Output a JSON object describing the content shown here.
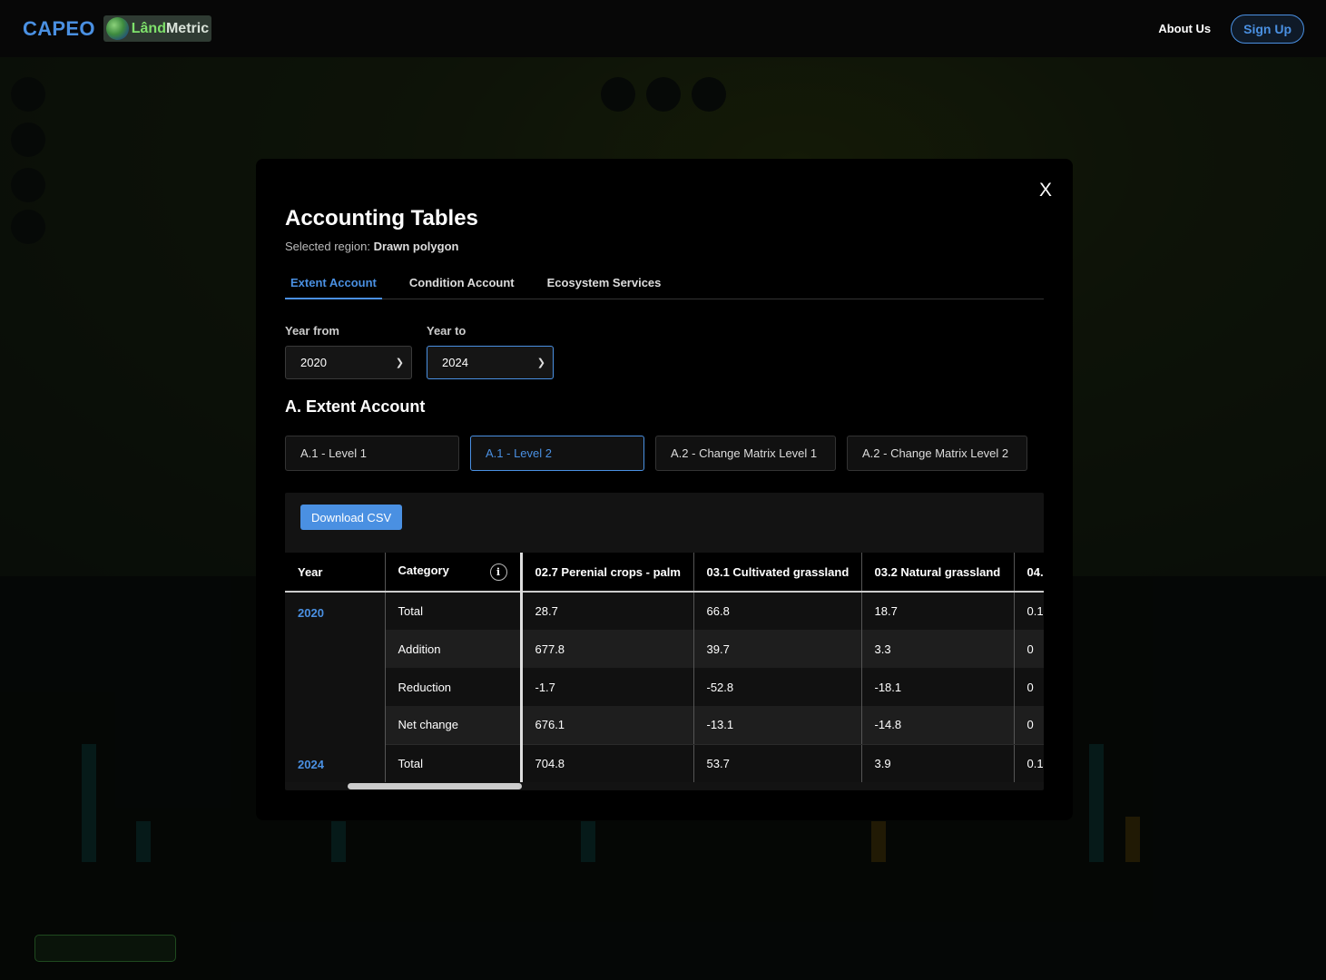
{
  "header": {
    "brand": "CAPEO",
    "logo_part1": "Lând",
    "logo_part2": "Metric",
    "about_label": "About Us",
    "signup_label": "Sign Up"
  },
  "modal": {
    "close_label": "X",
    "title": "Accounting Tables",
    "region_label": "Selected region:",
    "region_value": "Drawn polygon",
    "tabs": [
      "Extent Account",
      "Condition Account",
      "Ecosystem Services"
    ],
    "year_from": {
      "label": "Year from",
      "value": "2020"
    },
    "year_to": {
      "label": "Year to",
      "value": "2024"
    },
    "section_title": "A. Extent Account",
    "subtabs": [
      "A.1 - Level 1",
      "A.1 - Level 2",
      "A.2 - Change Matrix Level 1",
      "A.2 - Change Matrix Level 2"
    ],
    "download_label": "Download CSV",
    "table": {
      "headers": [
        "Year",
        "Category",
        "02.7 Perenial crops - palm",
        "03.1 Cultivated grassland",
        "03.2 Natural grassland",
        "04."
      ],
      "info_icon": "i",
      "rows": [
        {
          "year": "2020",
          "category": "Total",
          "cells": [
            "28.7",
            "66.8",
            "18.7",
            "0.1"
          ]
        },
        {
          "year": "",
          "category": "Addition",
          "cells": [
            "677.8",
            "39.7",
            "3.3",
            "0"
          ]
        },
        {
          "year": "",
          "category": "Reduction",
          "cells": [
            "-1.7",
            "-52.8",
            "-18.1",
            "0"
          ]
        },
        {
          "year": "",
          "category": "Net change",
          "cells": [
            "676.1",
            "-13.1",
            "-14.8",
            "0"
          ]
        },
        {
          "year": "2024",
          "category": "Total",
          "cells": [
            "704.8",
            "53.7",
            "3.9",
            "0.1"
          ]
        }
      ]
    }
  },
  "colors": {
    "accent": "#4a90e2",
    "background": "#000000"
  }
}
